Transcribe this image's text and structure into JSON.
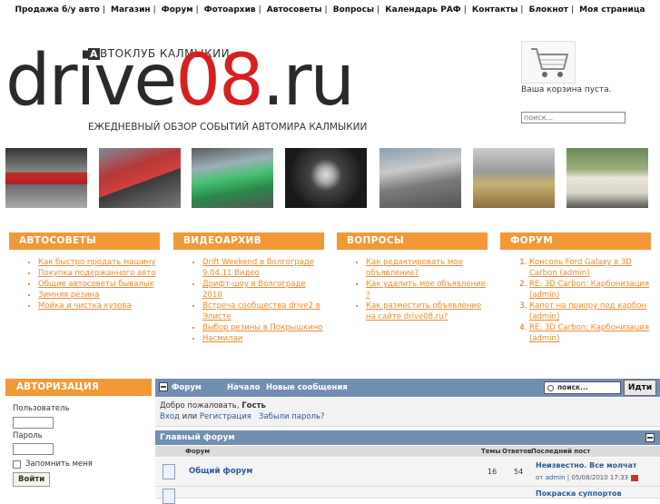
{
  "topnav": [
    "Продажа б/у авто",
    "Магазин",
    "Форум",
    "Фотоархив",
    "Автосоветы",
    "Вопросы",
    "Календарь РАФ",
    "Контакты",
    "Блокнот",
    "Моя страница"
  ],
  "logo": {
    "club": "АВТОКЛУБ КАЛМЫКИИ",
    "club_first": "А",
    "club_rest": "ВТОКЛУБ КАЛМЫКИИ",
    "wordmark_a": "drive",
    "wordmark_b": "08",
    ".ru": ".ru",
    "wordmark_c": ".ru",
    "tagline": "ЕЖЕДНЕВНЫЙ ОБЗОР СОБЫТИЙ АВТОМИРА КАЛМЫКИИ"
  },
  "cart": {
    "text": "Ваша корзина пуста.",
    "search_placeholder": "поиск..."
  },
  "boxes": {
    "avtosovety": {
      "title": "АВТОСОВЕТЫ",
      "items": [
        "Как быстро продать машину",
        "Покупка подержанного авто",
        "Общие автосоветы бывалых",
        "Зимняя резина",
        "Мойка и чистка кузова"
      ]
    },
    "video": {
      "title": "ВИДЕОАРХИВ",
      "items": [
        "Drift Weekend в Волгограде 9.04.11 Видео",
        "Дрифт-шоу в Волгограде 2010",
        "Встреча сообщества drive2 в Элисте",
        "Выбор резины в Покрышкино",
        "Насмилаи"
      ]
    },
    "voprosy": {
      "title": "ВОПРОСЫ",
      "items": [
        "Как редактировать мое объявление?",
        "Как удалить мое объявление ?",
        "Как разместить объявление на сайте drive08.ru?"
      ]
    },
    "forum": {
      "title": "ФОРУМ",
      "items": [
        "Консоль Ford Galaxy в 3D Carbon (admin)",
        "RE: 3D Carbon: Карбонизация (admin)",
        "Капот на приору под карбон (admin)",
        "RE: 3D Carbon: Карбонизация (admin)"
      ]
    }
  },
  "auth": {
    "title": "АВТОРИЗАЦИЯ",
    "user_label": "Пользователь",
    "pass_label": "Пароль",
    "remember": "Запомнить меня",
    "login": "Войти"
  },
  "forum_panel": {
    "title": "Форум",
    "home": "Начало",
    "new": "Новые сообщения",
    "search_placeholder": "поиск...",
    "go": "Идти",
    "welcome": "Добро пожаловать,",
    "guest": "Гость",
    "login": "Вход",
    "or": "или",
    "register": "Регистрация",
    "forgot": "Забыли пароль?",
    "main_title": "Главный форум",
    "cols": {
      "forum": "Форум",
      "topics": "Темы",
      "replies": "Ответов",
      "last": "Последний пост"
    },
    "rows": [
      {
        "name": "Общий форум",
        "topics": "16",
        "replies": "54",
        "last": "Неизвестно. Все молчат",
        "by": "от",
        "author": "admin",
        "date": "| 05/08/2010 17:33"
      },
      {
        "name": "",
        "topics": "",
        "replies": "",
        "last": "Покраска суппортов",
        "by": "",
        "author": "",
        "date": ""
      }
    ]
  }
}
